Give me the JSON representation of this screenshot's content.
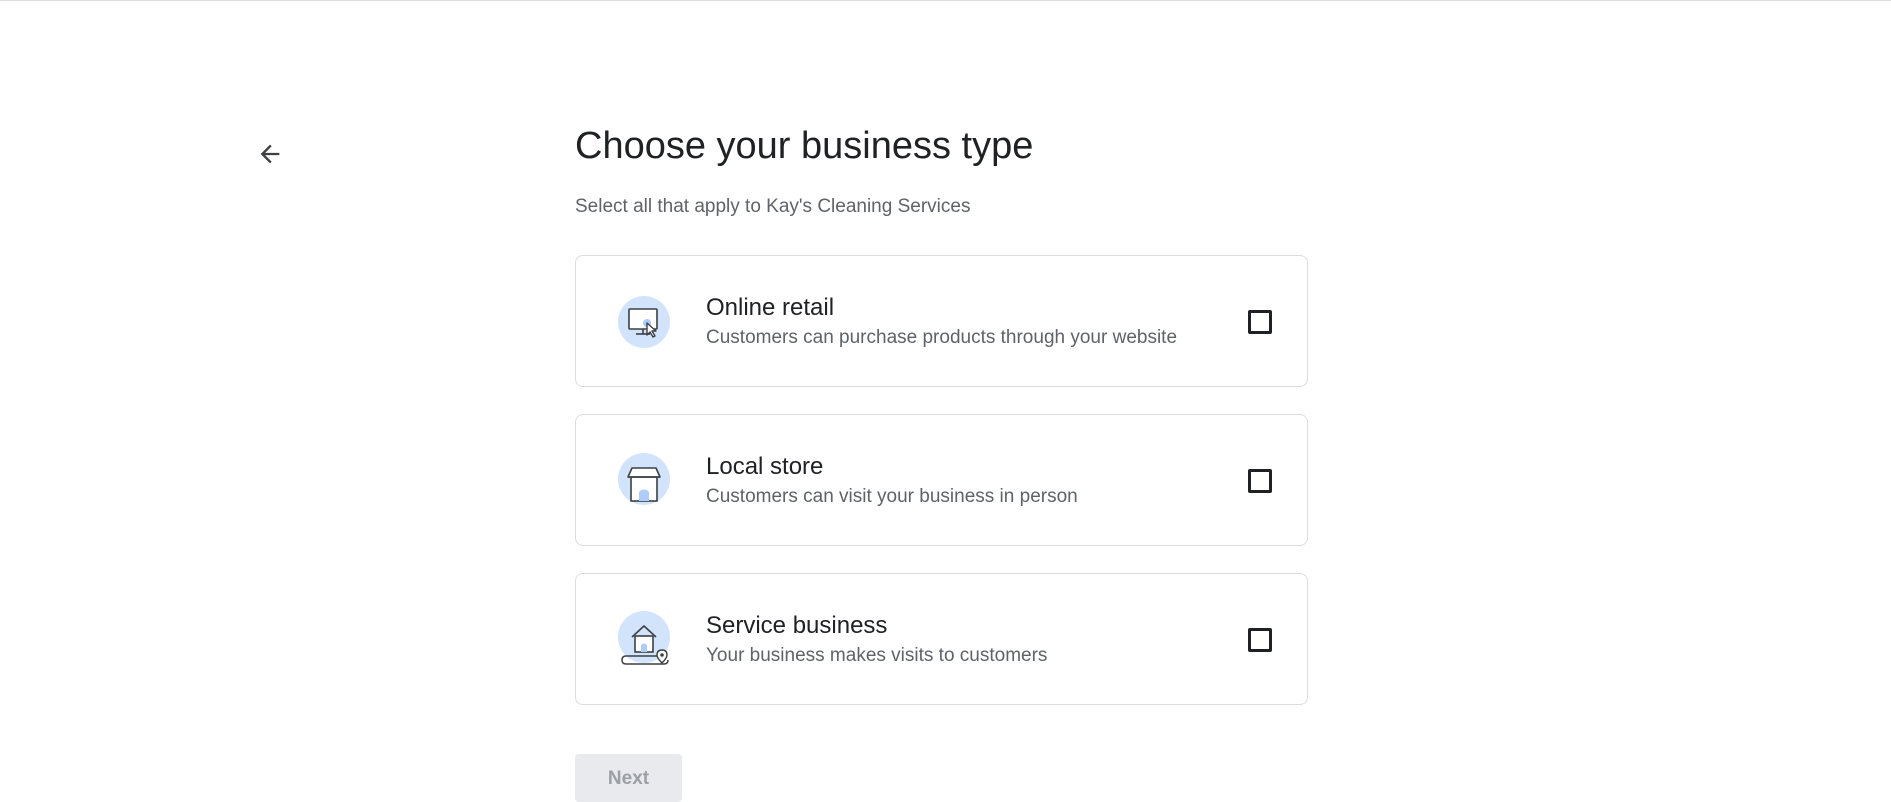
{
  "header": {
    "back_icon": "arrow-back-icon"
  },
  "main": {
    "title": "Choose your business type",
    "subtitle": "Select all that apply to Kay's Cleaning Services",
    "options": [
      {
        "title": "Online retail",
        "description": "Customers can purchase products through your website",
        "icon": "monitor-cursor-icon",
        "checked": false
      },
      {
        "title": "Local store",
        "description": "Customers can visit your business in person",
        "icon": "storefront-icon",
        "checked": false
      },
      {
        "title": "Service business",
        "description": "Your business makes visits to customers",
        "icon": "house-location-icon",
        "checked": false
      }
    ],
    "next_label": "Next"
  },
  "colors": {
    "accent_circle": "#d2e3fc",
    "accent_fill": "#aecbfa",
    "border": "#dadce0",
    "text_primary": "#202124",
    "text_secondary": "#5f6368",
    "disabled_bg": "#e8eaed",
    "disabled_text": "#9aa0a6"
  }
}
